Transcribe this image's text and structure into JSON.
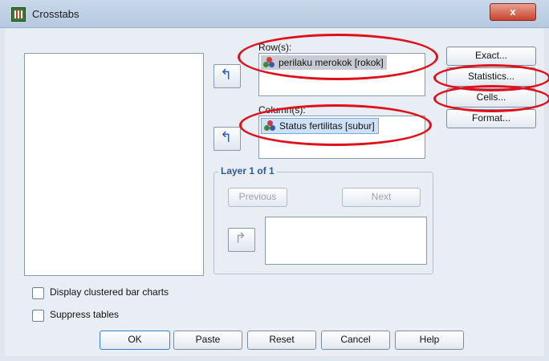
{
  "window": {
    "title": "Crosstabs",
    "close_label": "x"
  },
  "rows": {
    "label": "Row(s):",
    "item": "perilaku merokok [rokok]"
  },
  "columns": {
    "label": "Column(s):",
    "item": "Status fertilitas [subur]"
  },
  "layer": {
    "title": "Layer 1 of 1",
    "previous_label": "Previous",
    "next_label": "Next"
  },
  "side_buttons": {
    "exact": "Exact...",
    "statistics": "Statistics...",
    "cells": "Cells...",
    "format": "Format..."
  },
  "options": {
    "clustered_bar": "Display clustered bar charts",
    "suppress_tables": "Suppress tables"
  },
  "bottom_buttons": {
    "ok": "OK",
    "paste": "Paste",
    "reset": "Reset",
    "cancel": "Cancel",
    "help": "Help"
  },
  "colors": {
    "highlight_ellipse": "#e0101a",
    "arrow_blue": "#2f5bb7",
    "layer_title": "#2e5a9a"
  },
  "icons": {
    "move_arrow": "arrow-left-icon",
    "variable": "nominal-variable-icon"
  }
}
